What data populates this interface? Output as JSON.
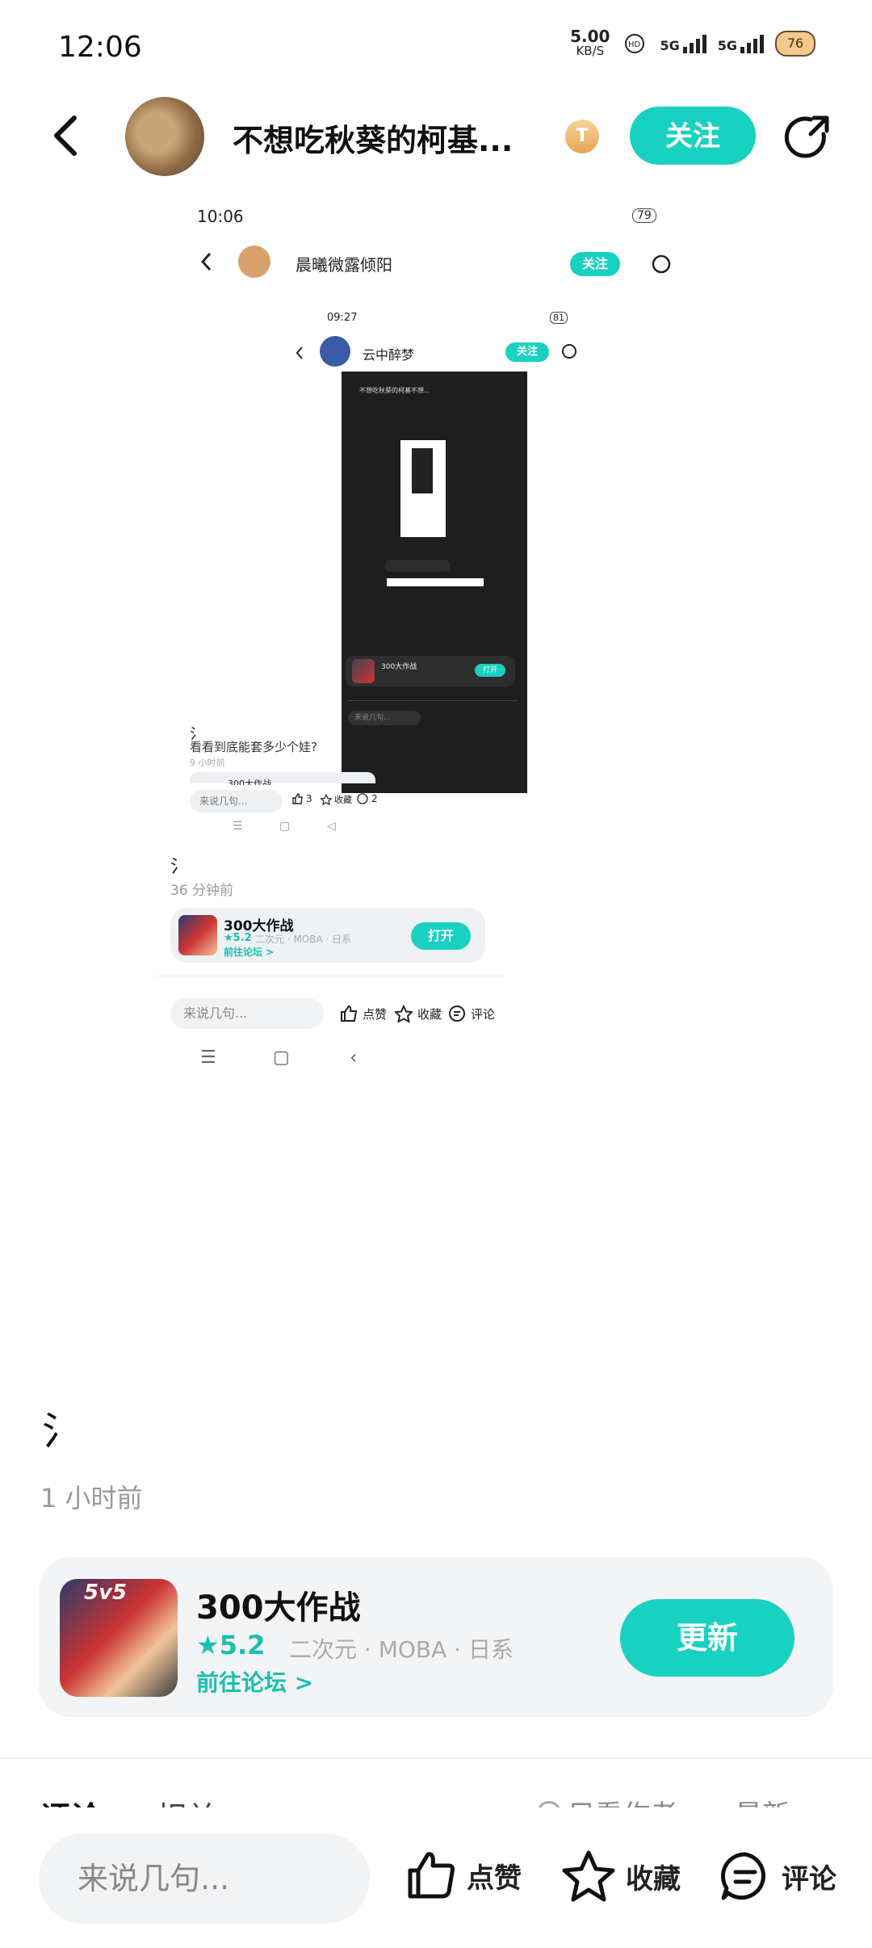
{
  "status_bar": {
    "time": "12:06",
    "net_speed": "5.00",
    "net_unit": "KB/S",
    "signal1": "5G",
    "signal2": "5G",
    "battery": "76"
  },
  "header": {
    "username": "不想吃秋葵的柯基...",
    "badge": "T",
    "follow_label": "关注"
  },
  "screenshot": {
    "status_time": "10:06",
    "battery": "79",
    "username": "晨曦微露倾阳",
    "follow_label": "关注",
    "inner": {
      "status_time": "09:27",
      "battery": "81",
      "username": "云中醉梦",
      "follow_label": "关注",
      "post_mark": "氵",
      "post_text": "看看到底能套多少个娃?",
      "post_time": "9 小时前",
      "game_title": "300大作战",
      "comment_placeholder": "来说几句...",
      "like_count": "3",
      "fav_label": "收藏",
      "comment_count": "2",
      "dark": {
        "username": "不想吃秋葵的柯基不想...",
        "game_title": "300大作战",
        "open_label": "打开",
        "placeholder": "来说几句..."
      }
    },
    "post_mark": "氵",
    "post_time": "36 分钟前",
    "game": {
      "title": "300大作战",
      "rating": "★5.2",
      "tags": "二次元 · MOBA · 日系",
      "forum": "前往论坛 >",
      "button": "打开"
    },
    "comment_placeholder": "来说几句...",
    "actions": {
      "like": "点赞",
      "fav": "收藏",
      "comment": "评论"
    }
  },
  "post": {
    "mark": "氵",
    "time": "1 小时前"
  },
  "game_card": {
    "icon_tag": "5v5",
    "title": "300大作战",
    "rating": "★5.2",
    "tags": "二次元 · MOBA · 日系",
    "forum_link": "前往论坛 >",
    "button": "更新"
  },
  "tabs_peek": {
    "comments": "评论",
    "related": "相关",
    "author_only": "只看作者",
    "latest": "最新"
  },
  "bottom_bar": {
    "comment_placeholder": "来说几句...",
    "like_label": "点赞",
    "fav_label": "收藏",
    "comment_label": "评论"
  }
}
